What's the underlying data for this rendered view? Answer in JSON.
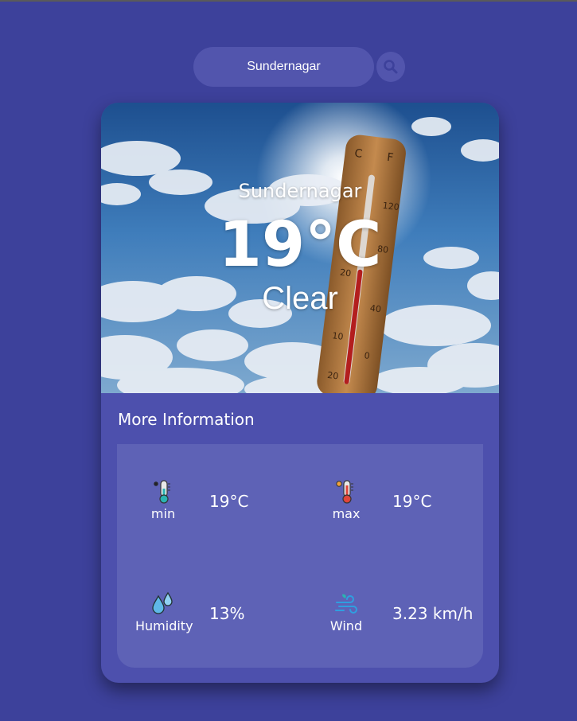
{
  "search": {
    "value": "Sundernagar",
    "icon": "search-icon"
  },
  "weather": {
    "city": "Sundernagar",
    "temperature": "19°C",
    "condition": "Clear"
  },
  "more_info": {
    "title": "More Information",
    "min": {
      "label": "min",
      "value": "19°C",
      "icon": "thermometer-cold-icon"
    },
    "max": {
      "label": "max",
      "value": "19°C",
      "icon": "thermometer-hot-icon"
    },
    "humidity": {
      "label": "Humidity",
      "value": "13%",
      "icon": "droplets-icon"
    },
    "wind": {
      "label": "Wind",
      "value": "3.23 km/h",
      "icon": "wind-icon"
    }
  },
  "colors": {
    "background": "#3d419b",
    "card": "#4d50ad",
    "panel": "#5e62b6",
    "search": "#5255ad"
  }
}
